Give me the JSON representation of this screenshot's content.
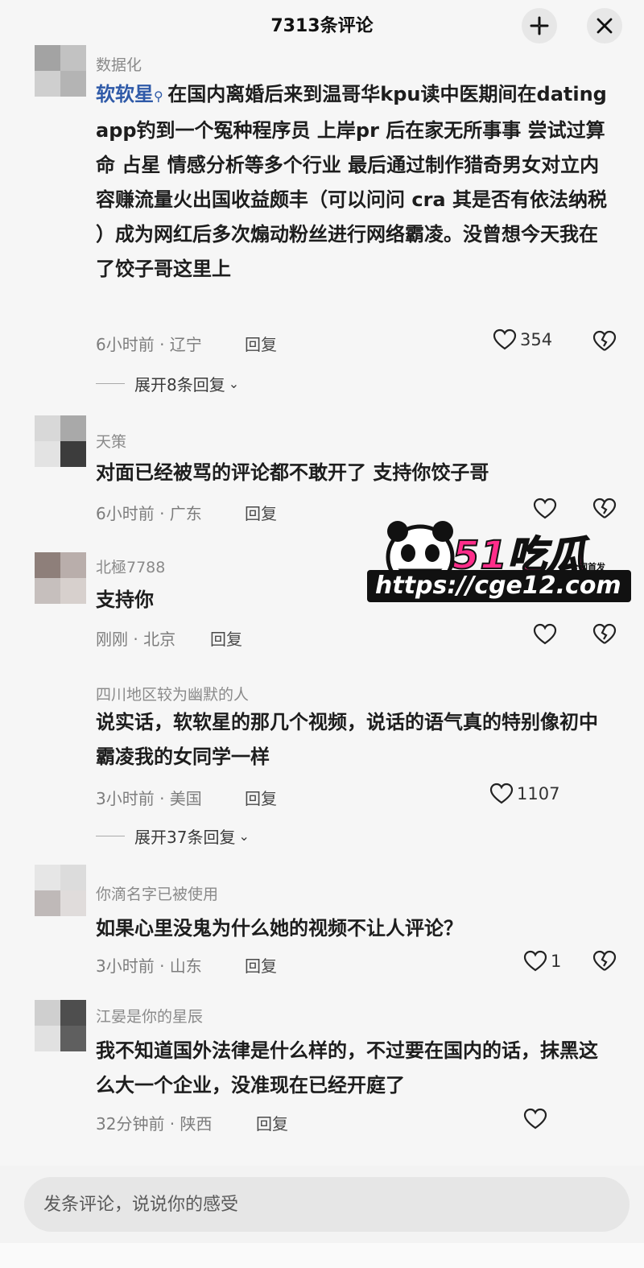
{
  "header": {
    "title": "7313条评论"
  },
  "comments": [
    {
      "username": "数据化",
      "mention": "软软星",
      "text": "在国内离婚后来到温哥华kpu读中医期间在dating app钓到一个冤种程序员 上岸pr 后在家无所事事 尝试过算命 占星 情感分析等多个行业 最后通过制作猎奇男女对立内容赚流量火出国收益颇丰（可以问问 cra 其是否有依法纳税 ）成为网红后多次煽动粉丝进行网络霸凌。没曾想今天我在了饺子哥这里上",
      "meta": "6小时前 · 辽宁",
      "reply": "回复",
      "likes": "354",
      "expand": "展开8条回复"
    },
    {
      "username": "天策",
      "text": "对面已经被骂的评论都不敢开了 支持你饺子哥",
      "meta": "6小时前 · 广东",
      "reply": "回复"
    },
    {
      "username": "北極7788",
      "text": "支持你",
      "meta": "刚刚 · 北京",
      "reply": "回复"
    },
    {
      "username": "四川地区较为幽默的人",
      "text": "说实话，软软星的那几个视频，说话的语气真的特别像初中霸凌我的女同学一样",
      "meta": "3小时前 · 美国",
      "reply": "回复",
      "likes": "1107",
      "expand": "展开37条回复"
    },
    {
      "username": "你滴名字已被使用",
      "text": "如果心里没鬼为什么她的视频不让人评论？",
      "meta": "3小时前 · 山东",
      "reply": "回复",
      "likes": "1"
    },
    {
      "username": "江晏是你的星辰",
      "text": "我不知道国外法律是什么样的，不过要在国内的话，抹黑这么大一个企业，没准现在已经开庭了",
      "meta": "32分钟前 · 陕西",
      "reply": "回复"
    }
  ],
  "watermark": {
    "brand": "51吃瓜",
    "badge": "全网首发",
    "url": "https://cge12.com"
  },
  "input": {
    "placeholder": "发条评论，说说你的感受"
  },
  "colors": {
    "mention": "#2f5aa8",
    "background": "#f6f6f6",
    "watermark_pink": "#ff2d8a"
  }
}
